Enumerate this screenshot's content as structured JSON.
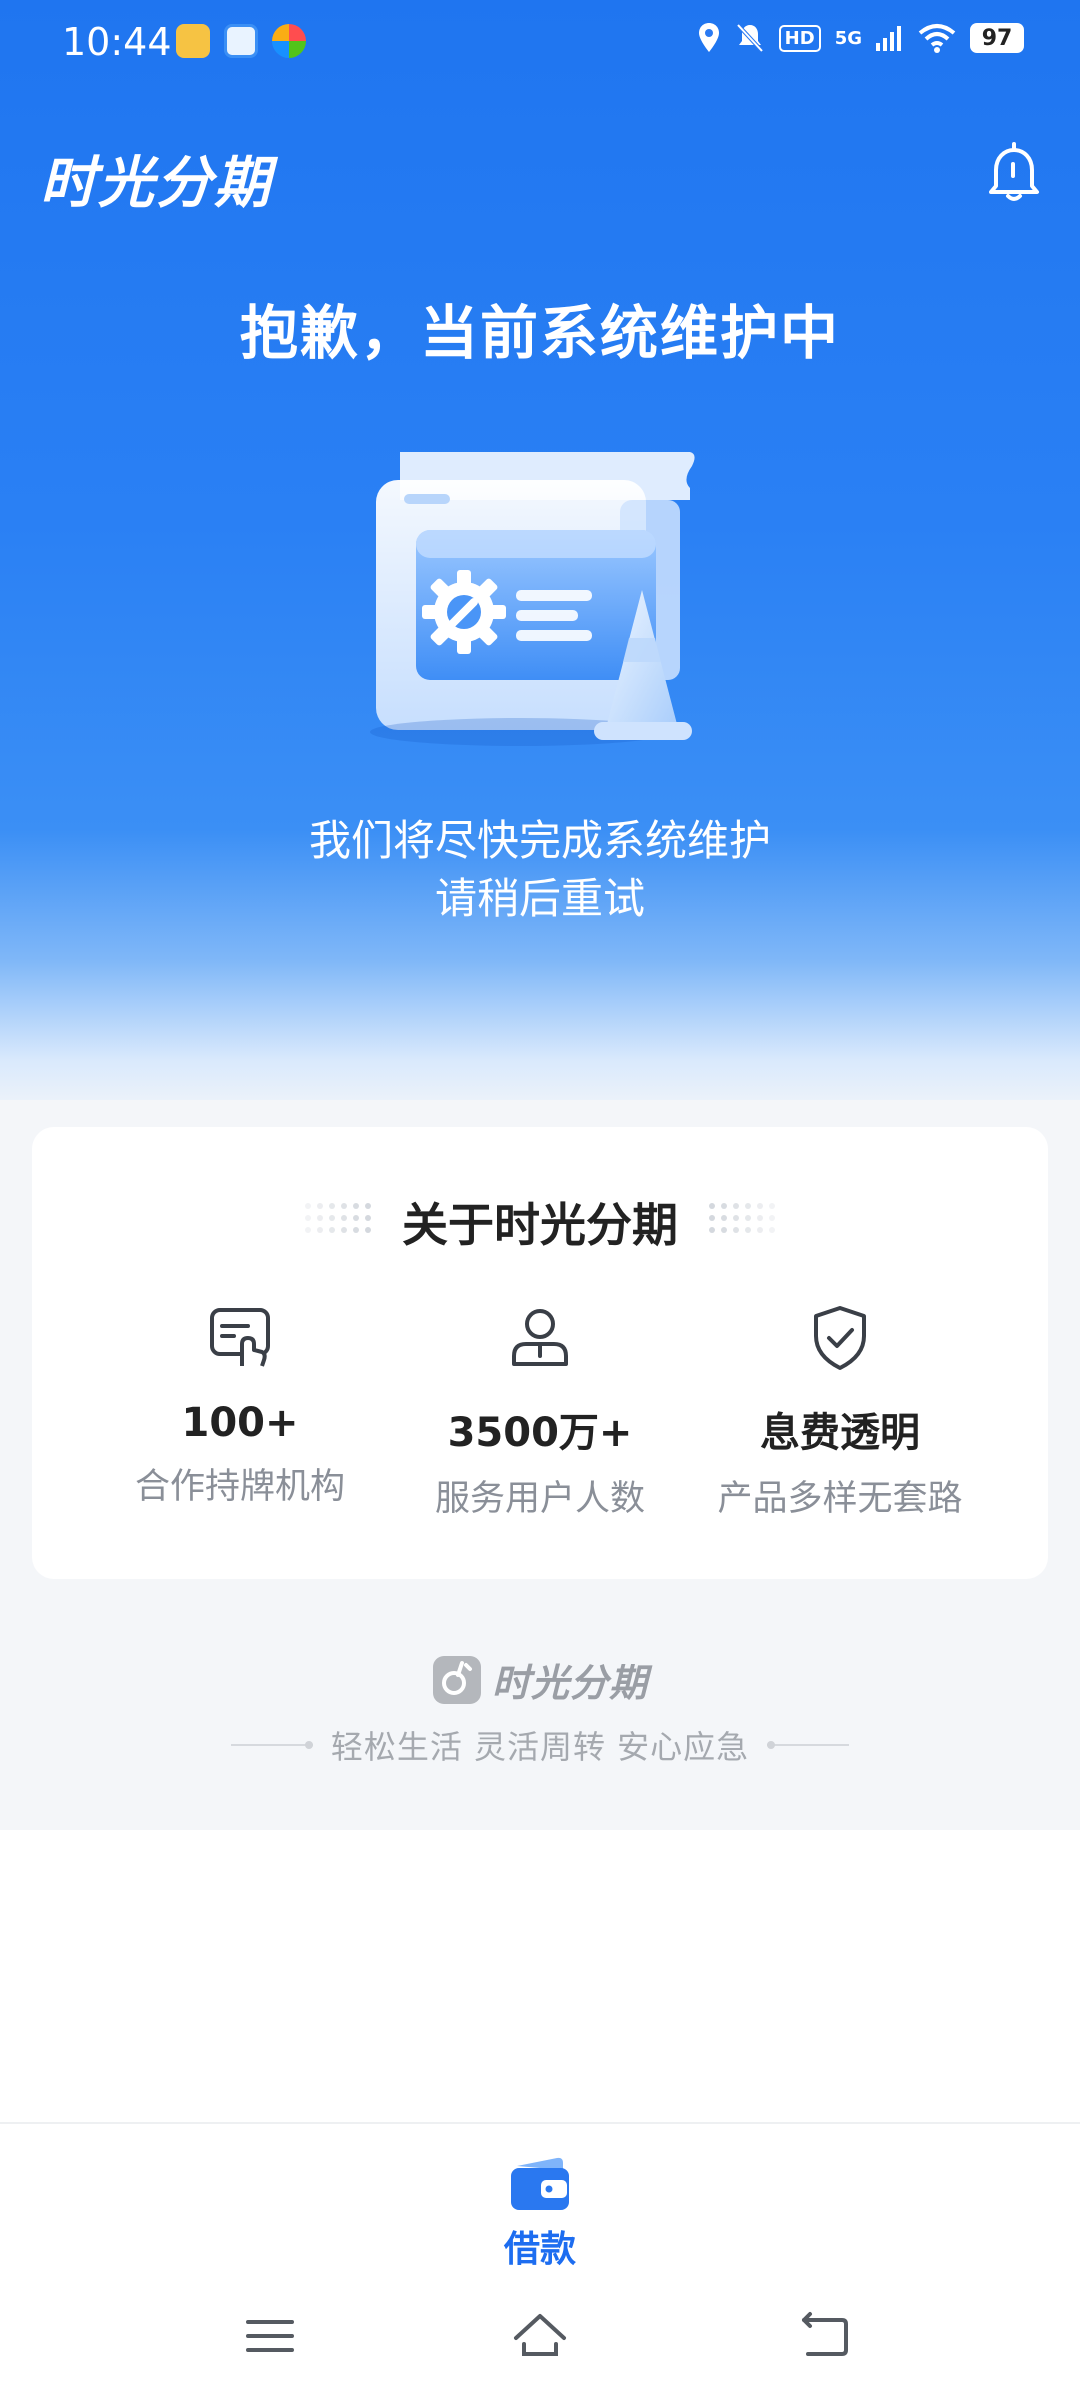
{
  "status_bar": {
    "time": "10:44",
    "hd": "HD",
    "network": "5G",
    "battery": "97"
  },
  "header": {
    "app_title": "时光分期",
    "bell_icon": "bell-icon"
  },
  "maintenance": {
    "title": "抱歉，当前系统维护中",
    "illustration": "maintenance-illustration",
    "line1": "我们将尽快完成系统维护",
    "line2": "请稍后重试"
  },
  "about": {
    "title": "关于时光分期",
    "features": [
      {
        "icon": "institution-icon",
        "value": "100+",
        "label": "合作持牌机构"
      },
      {
        "icon": "user-icon",
        "value": "3500万+",
        "label": "服务用户人数"
      },
      {
        "icon": "shield-check-icon",
        "value": "息费透明",
        "label": "产品多样无套路"
      }
    ]
  },
  "footer": {
    "brand": "时光分期",
    "slogan": "轻松生活 灵活周转 安心应急"
  },
  "bottom_nav": {
    "items": [
      {
        "label": "借款",
        "icon": "wallet-icon",
        "active": true
      }
    ]
  },
  "colors": {
    "primary": "#1d6df0",
    "hero_top": "#1f75f0",
    "text_dark": "#222222",
    "text_gray": "#8a8f98"
  }
}
